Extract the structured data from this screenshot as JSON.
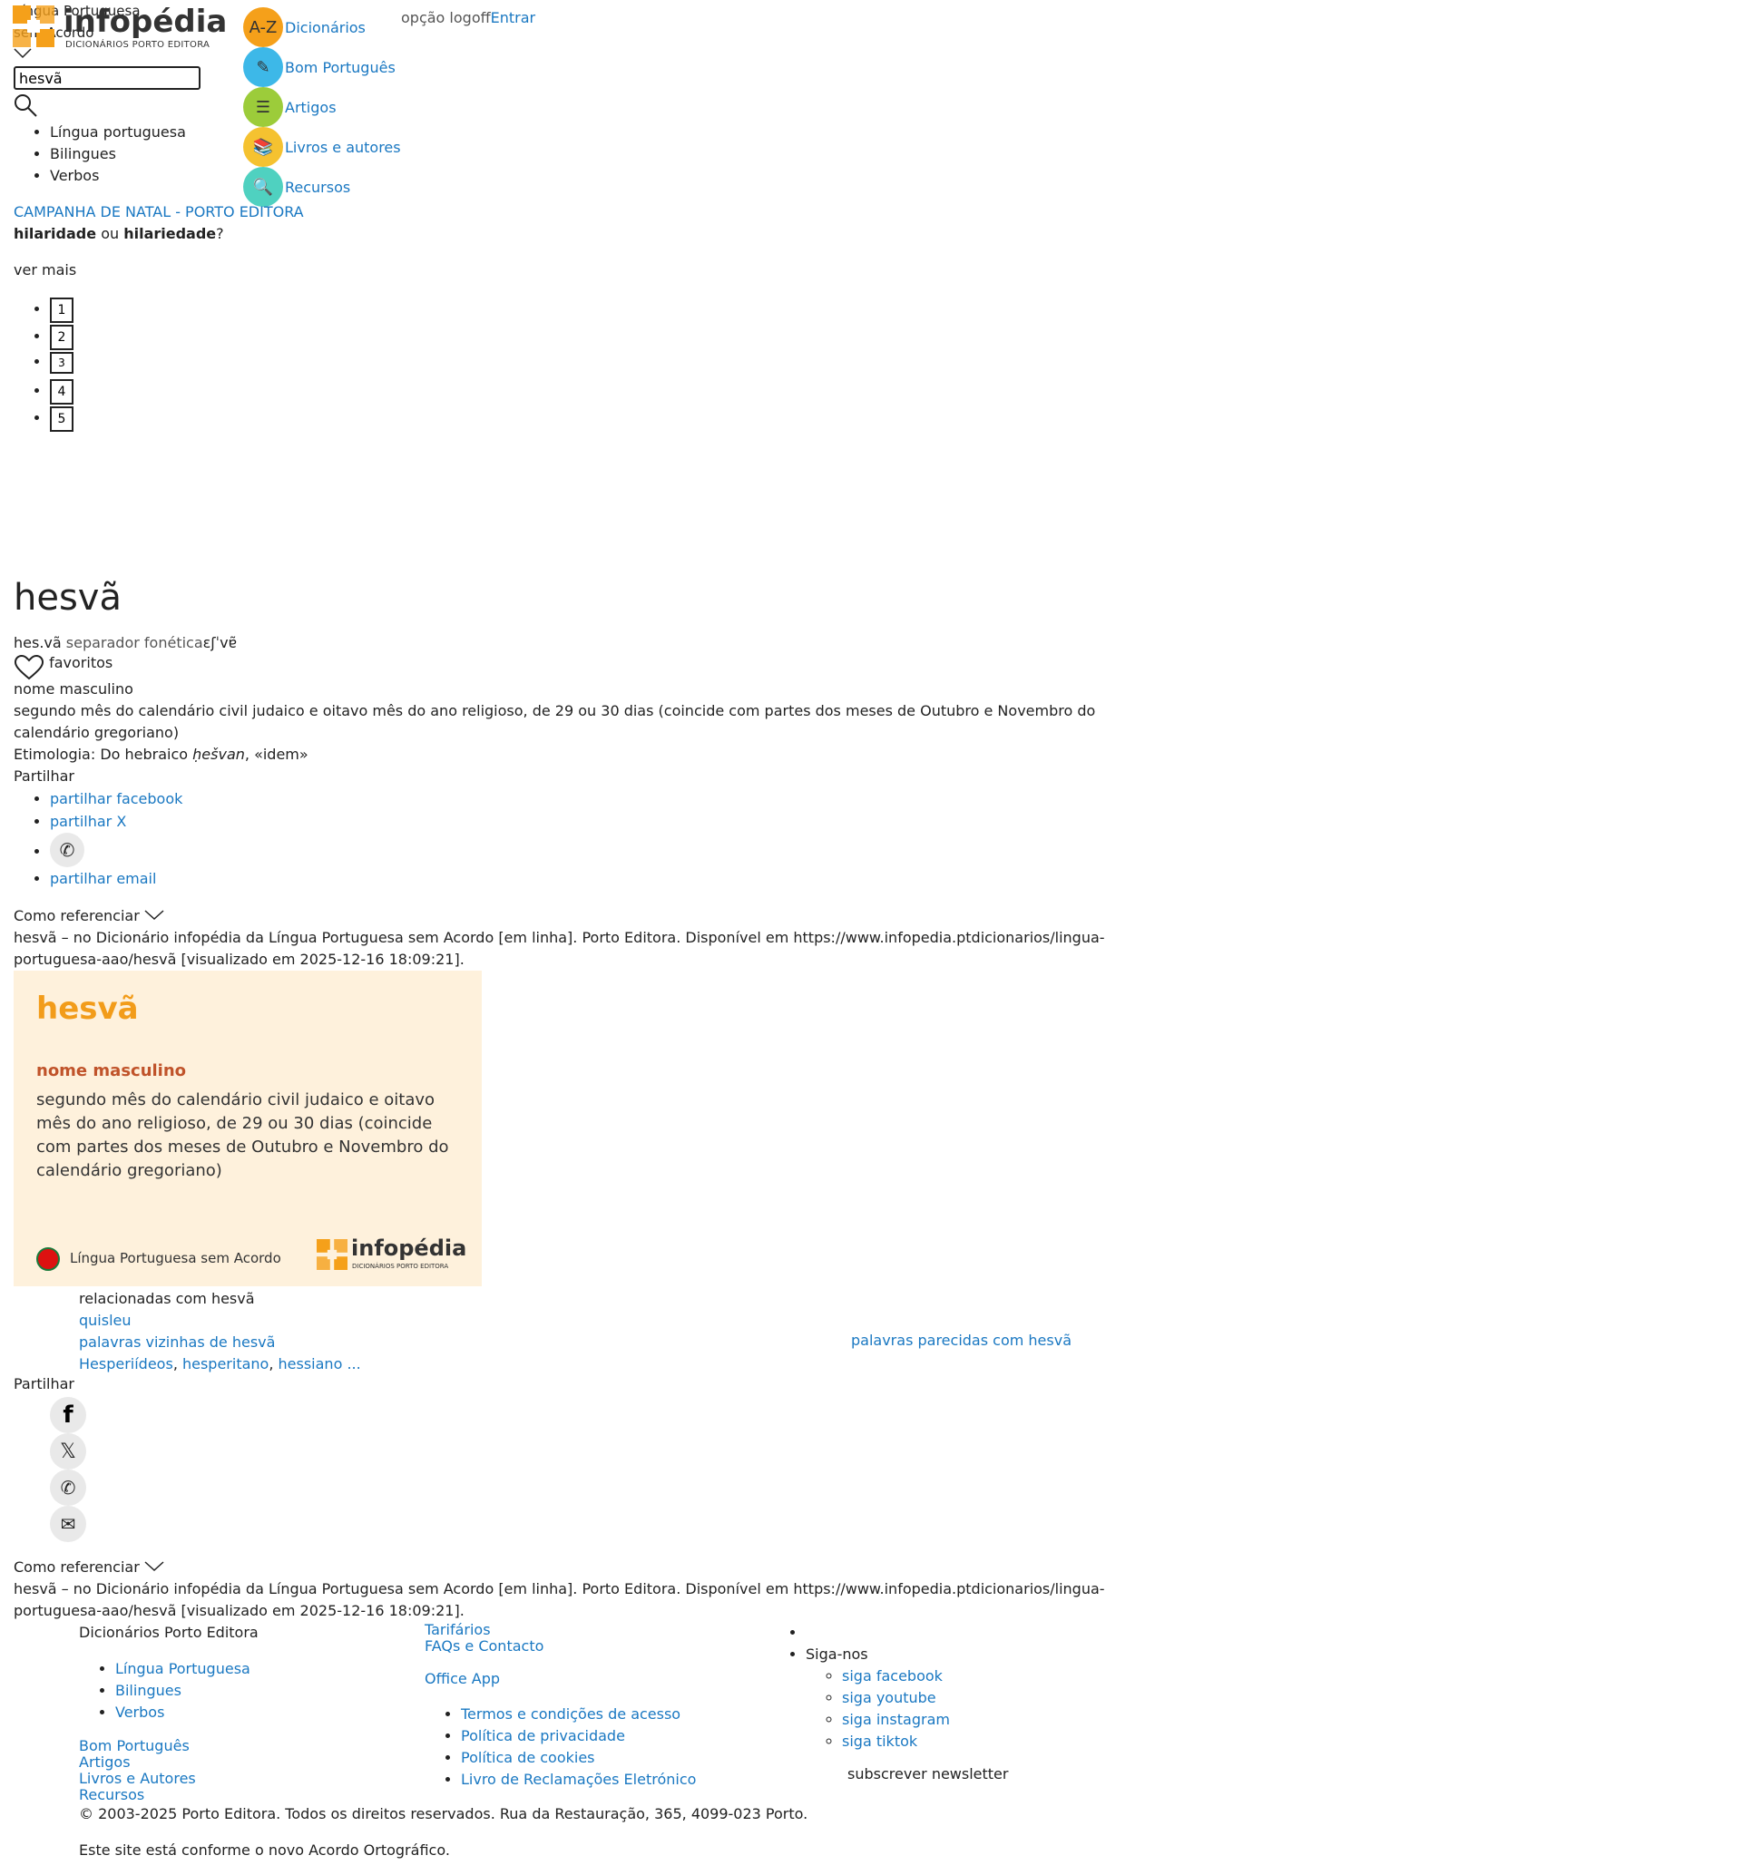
{
  "header": {
    "logo": {
      "name": "infopédia",
      "subtitle": "DICIONÁRIOS PORTO EDITORA"
    },
    "dictionary_label": "Língua Portuguesa",
    "dictionary_sub": "sem Acordo",
    "search_value": "hesvã",
    "modes": [
      "Língua portuguesa",
      "Bilingues",
      "Verbos"
    ],
    "nav": [
      {
        "label": "Dicionários",
        "icon": "dictionary-icon",
        "color": "#f5a01a"
      },
      {
        "label": "Bom Português",
        "icon": "pencil-note-icon",
        "color": "#3db8e8"
      },
      {
        "label": "Artigos",
        "icon": "article-icon",
        "color": "#9ccc3a"
      },
      {
        "label": "Livros e autores",
        "icon": "books-icon",
        "color": "#f5c230"
      },
      {
        "label": "Recursos",
        "icon": "resources-icon",
        "color": "#4fd1c0"
      }
    ],
    "logoff_alt": "opção logoff",
    "login": "Entrar"
  },
  "promo": {
    "campaign_alt": "CAMPANHA DE NATAL - PORTO EDITORA",
    "question_a": "hilaridade",
    "question_or": "ou",
    "question_b": "hilariedade",
    "question_end": "?",
    "ver_mais": "ver mais",
    "pages": [
      "1",
      "2",
      "3",
      "4",
      "5"
    ]
  },
  "entry": {
    "headword": "hesvã",
    "syllables": "hes.vã",
    "separator_alt": "separador fonética",
    "phonetic": "ɛʃˈvɐ̃",
    "favorites": "favoritos",
    "grammar": "nome masculino",
    "definition": "segundo mês do calendário civil judaico e oitavo mês do ano religioso, de 29 ou 30 dias (coincide com partes dos meses de Outubro e Novembro do",
    "definition_2": "calendário gregoriano)",
    "etym_prefix": "Etimologia: Do hebraico ",
    "etym_word": "ḥešvan",
    "etym_suffix": ", «idem»",
    "share_label": "Partilhar",
    "share_links": [
      "partilhar facebook",
      "partilhar X",
      "partilhar email"
    ],
    "cite_label": "Como referenciar",
    "cite_1": "hesvã – no Dicionário infopédia da Língua Portuguesa sem Acordo [em linha]. Porto Editora. Disponível em https://www.infopedia.ptdicionarios/lingua-",
    "cite_2": "portuguesa-aao/hesvã [visualizado em 2025-12-16 18:09:21]."
  },
  "card": {
    "word": "hesvã",
    "grammar": "nome masculino",
    "definition": "segundo mês do calendário civil judaico e oitavo mês do ano religioso, de 29 ou 30 dias (coincide com partes dos meses de Outubro e Novembro do calendário gregoriano)",
    "dictionary": "Língua Portuguesa sem Acordo",
    "logo": "infopédia",
    "logo_sub": "DICIONÁRIOS PORTO EDITORA"
  },
  "related": {
    "label": "relacionadas com hesvã",
    "word": "quisleu",
    "neighbors_label": "palavras vizinhas de hesvã",
    "neighbors": [
      "Hesperiídeos",
      "hesperitano",
      "hessiano ..."
    ],
    "similar_alt": "palavras parecidas com hesvã"
  },
  "share2": {
    "label": "Partilhar",
    "icons": [
      "facebook-icon",
      "x-icon",
      "whatsapp-icon",
      "email-icon"
    ],
    "cite_label": "Como referenciar",
    "cite_1": "hesvã – no Dicionário infopédia da Língua Portuguesa sem Acordo [em linha]. Porto Editora. Disponível em https://www.infopedia.ptdicionarios/lingua-",
    "cite_2": "portuguesa-aao/hesvã [visualizado em 2025-12-16 18:09:21]."
  },
  "footer": {
    "col1_title": "Dicionários Porto Editora",
    "col1_list": [
      "Língua Portuguesa",
      "Bilingues",
      "Verbos"
    ],
    "col1_links": [
      "Bom Português",
      "Artigos",
      "Livros e Autores",
      "Recursos"
    ],
    "col2_links": [
      "Tarifários",
      "FAQs e Contacto"
    ],
    "office": "Office App",
    "col2_list": [
      "Termos e condições de acesso",
      "Política de privacidade",
      "Política de cookies",
      "Livro de Reclamações Eletrónico"
    ],
    "follow": "Siga-nos",
    "social": [
      "siga facebook",
      "siga youtube",
      "siga instagram",
      "siga tiktok"
    ],
    "newsletter": "subscrever newsletter",
    "copyright": "© 2003-2025 Porto Editora. Todos os direitos reservados. Rua da Restauração, 365, 4099-023 Porto.",
    "acordo": "Este site está conforme o novo Acordo Ortográfico."
  }
}
